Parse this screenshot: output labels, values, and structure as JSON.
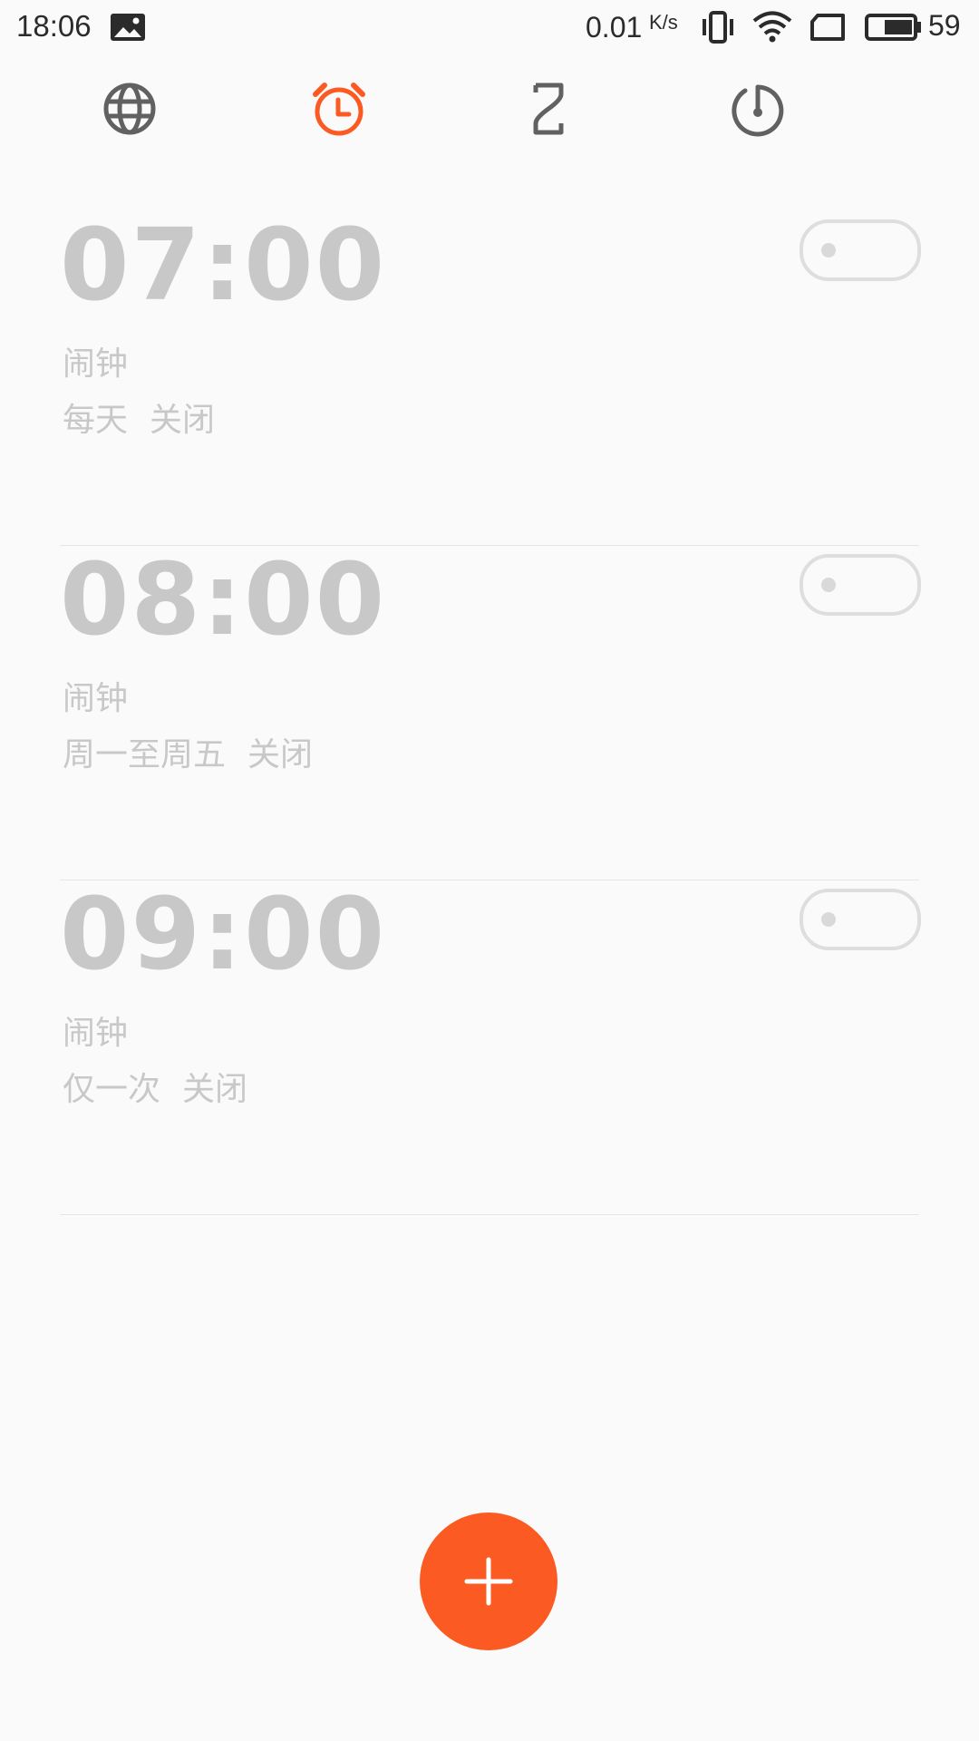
{
  "status_bar": {
    "time": "18:06",
    "net_speed": "0.01",
    "net_unit": "K/s",
    "battery": "59",
    "icons": [
      "gallery-icon",
      "vibrate-icon",
      "wifi-icon",
      "sim-icon",
      "battery-icon"
    ]
  },
  "tabs": [
    {
      "name": "world-clock",
      "icon": "globe-icon",
      "active": false
    },
    {
      "name": "alarm",
      "icon": "alarm-clock-icon",
      "active": true
    },
    {
      "name": "timer",
      "icon": "hourglass-icon",
      "active": false
    },
    {
      "name": "stopwatch",
      "icon": "stopwatch-icon",
      "active": false
    }
  ],
  "colors": {
    "accent": "#fb5b23",
    "icon_inactive": "#616161",
    "disabled_text": "#c8c8c8",
    "background": "#fafafa"
  },
  "alarms": [
    {
      "time": "07:00",
      "label": "闹钟",
      "repeat": "每天",
      "status": "关闭",
      "enabled": false
    },
    {
      "time": "08:00",
      "label": "闹钟",
      "repeat": "周一至周五",
      "status": "关闭",
      "enabled": false
    },
    {
      "time": "09:00",
      "label": "闹钟",
      "repeat": "仅一次",
      "status": "关闭",
      "enabled": false
    }
  ],
  "fab": {
    "icon": "plus-icon"
  }
}
